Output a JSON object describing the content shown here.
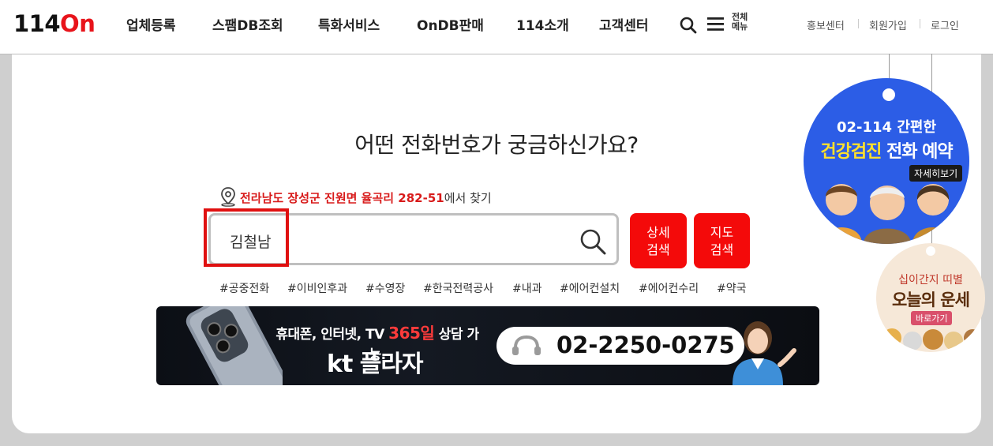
{
  "header": {
    "logo": {
      "part1": "114",
      "part2": "On"
    },
    "nav": [
      "업체등록",
      "스팸DB조회",
      "특화서비스",
      "OnDB판매",
      "114소개",
      "고객센터"
    ],
    "all_menu": {
      "line1": "전체",
      "line2": "메뉴"
    },
    "utility": [
      "홍보센터",
      "회원가입",
      "로그인"
    ]
  },
  "main": {
    "headline": "어떤 전화번호가 궁금하신가요?",
    "location": {
      "address": "전라남도 장성군 진원면 율곡리 282-51",
      "suffix": "에서 찾기"
    },
    "search": {
      "value": "김철남"
    },
    "buttons": {
      "detail": {
        "line1": "상세",
        "line2": "검색"
      },
      "map": {
        "line1": "지도",
        "line2": "검색"
      }
    },
    "tags": [
      "#공중전화",
      "#이비인후과",
      "#수영장",
      "#한국전력공사",
      "#내과",
      "#에어컨설치",
      "#에어컨수리",
      "#약국"
    ]
  },
  "banner": {
    "line_pre": "휴대폰, 인터넷, TV ",
    "highlight": "365일",
    "line_post": " 상담 가능.",
    "brand": "kt 플라자",
    "phone": "02-2250-0275"
  },
  "side": {
    "health": {
      "line1": "02-114 간편한",
      "line2_highlight": "건강검진",
      "line2_rest": " 전화 예약",
      "more": "자세히보기"
    },
    "fortune": {
      "line1": "십이간지 띠별",
      "line2": "오늘의 운세",
      "btn": "바로가기"
    }
  },
  "colors": {
    "brand_red": "#e8141b",
    "button_red": "#f40a0a",
    "circle_blue": "#2c5de6"
  }
}
